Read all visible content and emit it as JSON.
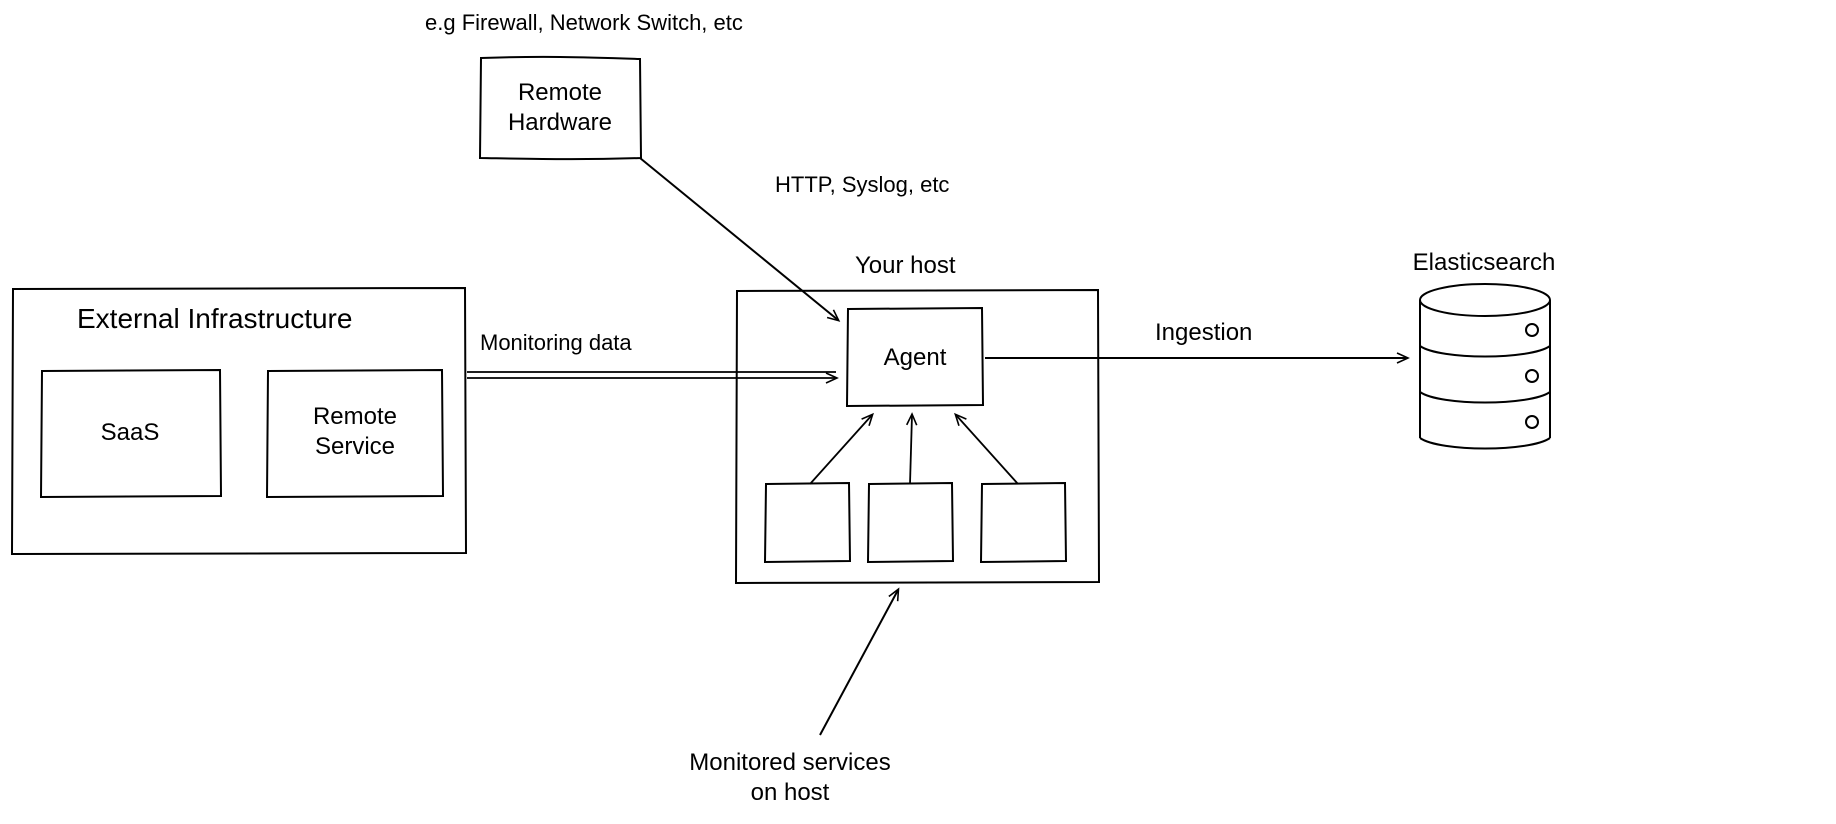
{
  "annotations": {
    "remote_hw_example": "e.g Firewall, Network Switch, etc",
    "http_syslog": "HTTP, Syslog, etc",
    "monitoring_data": "Monitoring data",
    "ingestion": "Ingestion",
    "monitored_services_l1": "Monitored services",
    "monitored_services_l2": "on host"
  },
  "boxes": {
    "remote_hw_l1": "Remote",
    "remote_hw_l2": "Hardware",
    "ext_infra": "External Infrastructure",
    "saas": "SaaS",
    "remote_svc_l1": "Remote",
    "remote_svc_l2": "Service",
    "your_host": "Your host",
    "agent": "Agent",
    "elasticsearch": "Elasticsearch"
  }
}
